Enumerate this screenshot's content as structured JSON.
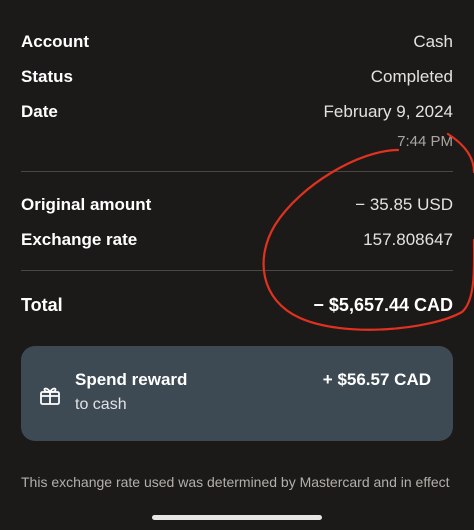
{
  "details": {
    "account": {
      "label": "Account",
      "value": "Cash"
    },
    "status": {
      "label": "Status",
      "value": "Completed"
    },
    "date": {
      "label": "Date",
      "value": "February 9, 2024",
      "time": "7:44 PM"
    },
    "original_amount": {
      "label": "Original amount",
      "value": "− 35.85 USD"
    },
    "exchange_rate": {
      "label": "Exchange rate",
      "value": "157.808647"
    },
    "total": {
      "label": "Total",
      "value": "− $5,657.44 CAD"
    }
  },
  "reward": {
    "title": "Spend reward",
    "subtitle": "to cash",
    "amount": "+ $56.57 CAD",
    "icon": "gift-icon"
  },
  "footnote": "This exchange rate used was determined by Mastercard and in effect",
  "colors": {
    "background": "#1c1a19",
    "card": "#3e4a53",
    "annotation": "#e0321f"
  }
}
